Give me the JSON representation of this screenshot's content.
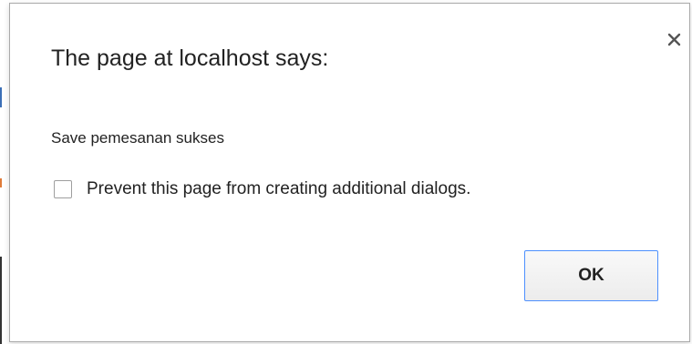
{
  "dialog": {
    "title": "The page at localhost says:",
    "message": "Save pemesanan sukses",
    "checkbox": {
      "label": "Prevent this page from creating additional dialogs.",
      "checked": false
    },
    "ok_label": "OK",
    "close_icon": "close-icon",
    "colors": {
      "button_border": "#4d90fe",
      "dialog_border": "#a9a9a9",
      "text": "#222222"
    }
  }
}
